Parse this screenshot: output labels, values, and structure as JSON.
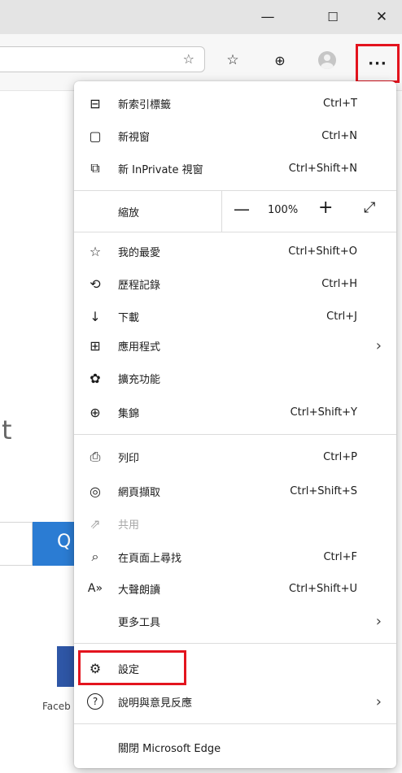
{
  "window_controls": {
    "minimize": "—",
    "maximize": "☐",
    "close": "✕"
  },
  "toolbar": {
    "more_label": "···"
  },
  "background": {
    "glyph": "t",
    "search_glyph": "Q",
    "facebook_label": "Faceb"
  },
  "menu": {
    "group1": [
      {
        "icon": "new-tab-icon",
        "glyph": "⊟",
        "label": "新索引標籤",
        "shortcut": "Ctrl+T"
      },
      {
        "icon": "new-window-icon",
        "glyph": "▢",
        "label": "新視窗",
        "shortcut": "Ctrl+N"
      },
      {
        "icon": "inprivate-icon",
        "glyph": "⧉",
        "label": "新 InPrivate 視窗",
        "shortcut": "Ctrl+Shift+N"
      }
    ],
    "zoom": {
      "label": "縮放",
      "minus": "—",
      "value": "100%",
      "plus": "+",
      "fullscreen": "⤢"
    },
    "group2": [
      {
        "icon": "favorites-icon",
        "glyph": "☆",
        "label": "我的最愛",
        "shortcut": "Ctrl+Shift+O"
      },
      {
        "icon": "history-icon",
        "glyph": "⟲",
        "label": "歷程記錄",
        "shortcut": "Ctrl+H"
      },
      {
        "icon": "download-icon",
        "glyph": "↓",
        "label": "下載",
        "shortcut": "Ctrl+J"
      },
      {
        "icon": "apps-icon",
        "glyph": "⊞",
        "label": "應用程式",
        "shortcut": "",
        "chevron": "›"
      },
      {
        "icon": "extensions-icon",
        "glyph": "✿",
        "label": "擴充功能",
        "shortcut": ""
      },
      {
        "icon": "collections-icon",
        "glyph": "⊕",
        "label": "集錦",
        "shortcut": "Ctrl+Shift+Y"
      }
    ],
    "group3": [
      {
        "icon": "print-icon",
        "glyph": "⎙",
        "label": "列印",
        "shortcut": "Ctrl+P"
      },
      {
        "icon": "web-capture-icon",
        "glyph": "◎",
        "label": "網頁擷取",
        "shortcut": "Ctrl+Shift+S"
      },
      {
        "icon": "share-icon",
        "glyph": "⇗",
        "label": "共用",
        "shortcut": "",
        "disabled": true
      },
      {
        "icon": "find-icon",
        "glyph": "⌕",
        "label": "在頁面上尋找",
        "shortcut": "Ctrl+F"
      },
      {
        "icon": "read-aloud-icon",
        "glyph": "A»",
        "label": "大聲朗讀",
        "shortcut": "Ctrl+Shift+U"
      },
      {
        "icon": "more-tools-icon",
        "glyph": "",
        "label": "更多工具",
        "shortcut": "",
        "chevron": "›"
      }
    ],
    "group4": [
      {
        "icon": "settings-icon",
        "glyph": "⚙",
        "label": "設定",
        "shortcut": ""
      },
      {
        "icon": "help-icon",
        "glyph": "?",
        "label": "說明與意見反應",
        "shortcut": "",
        "chevron": "›"
      }
    ],
    "close_label": "關閉 Microsoft Edge"
  }
}
